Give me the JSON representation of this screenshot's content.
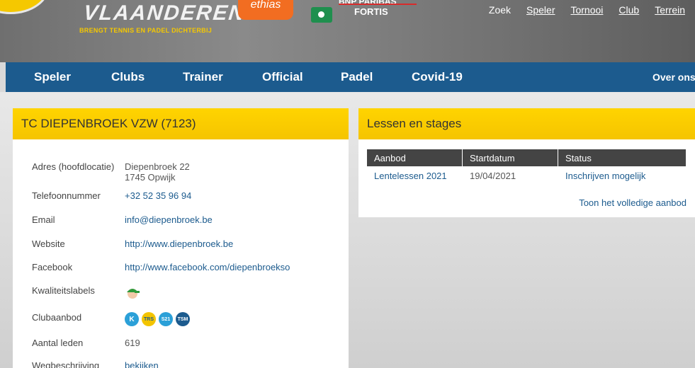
{
  "header": {
    "logo_word": "VLAANDEREN",
    "logo_tagline": "BRENGT TENNIS EN PADEL DICHTERBIJ",
    "sponsor_orange": "ethias",
    "sponsor_bnp_top": "BNP PARIBAS",
    "sponsor_bnp_bottom": "FORTIS",
    "utility_links": [
      "Zoek",
      "Speler",
      "Tornooi",
      "Club",
      "Terrein"
    ]
  },
  "nav": {
    "items": [
      "Speler",
      "Clubs",
      "Trainer",
      "Official",
      "Padel",
      "Covid-19",
      "Over ons"
    ]
  },
  "club": {
    "title": "TC DIEPENBROEK VZW (7123)",
    "rows": [
      {
        "label": "Adres (hoofdlocatie)",
        "value_line1": "Diepenbroek 22",
        "value_line2": "1745 Opwijk"
      },
      {
        "label": "Telefoonnummer",
        "value": "+32 52 35 96 94"
      },
      {
        "label": "Email",
        "value": "info@diepenbroek.be"
      },
      {
        "label": "Website",
        "value": "http://www.diepenbroek.be"
      },
      {
        "label": "Facebook",
        "value": "http://www.facebook.com/diepenbroekso"
      },
      {
        "label": "Kwaliteitslabels"
      },
      {
        "label": "Clubaanbod",
        "badges": [
          "K",
          "TRS",
          "S21",
          "TSM"
        ]
      },
      {
        "label": "Aantal leden",
        "value": "619"
      },
      {
        "label": "Wegbeschrijving",
        "value": "bekijken"
      }
    ]
  },
  "lessons": {
    "title": "Lessen en stages",
    "columns": [
      "Aanbod",
      "Startdatum",
      "Status"
    ],
    "rows": [
      {
        "aanbod": "Lentelessen 2021",
        "startdatum": "19/04/2021",
        "status": "Inschrijven mogelijk"
      }
    ],
    "full_offer_link": "Toon het volledige aanbod"
  },
  "colors": {
    "brand_blue": "#1c5b8e",
    "accent_yellow": "#ffd400",
    "table_header": "#444444"
  }
}
